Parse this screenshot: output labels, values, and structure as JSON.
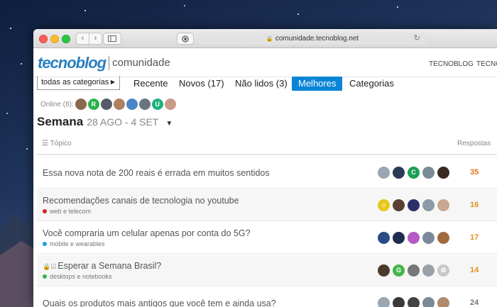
{
  "browser": {
    "url": "comunidade.tecnoblog.net",
    "nav_back": "‹",
    "nav_forward": "›",
    "reload": "↻"
  },
  "header": {
    "logo_main": "tecnoblog",
    "logo_sub": "comunidade",
    "links": [
      "TECNOBLOG",
      "TECNO"
    ]
  },
  "nav": {
    "categories_dropdown": "todas as categorias",
    "tabs": [
      "Recente",
      "Novos (17)",
      "Não lidos (3)",
      "Melhores",
      "Categorias"
    ],
    "active_tab": "Melhores"
  },
  "online": {
    "label": "Online (8):",
    "avatars": [
      {
        "letter": "",
        "color": "#8a6a4a"
      },
      {
        "letter": "R",
        "color": "#2bb24c"
      },
      {
        "letter": "",
        "color": "#555c66"
      },
      {
        "letter": "",
        "color": "#b08060"
      },
      {
        "letter": "",
        "color": "#4a86c8"
      },
      {
        "letter": "",
        "color": "#6a7480"
      },
      {
        "letter": "U",
        "color": "#1fb27c"
      },
      {
        "letter": "",
        "color": "#c89a88"
      }
    ]
  },
  "period": {
    "title": "Semana",
    "range": "28 AGO - 4 SET"
  },
  "table": {
    "topic_header": "Tópico",
    "replies_header": "Respostas",
    "rows": [
      {
        "title": "Essa nova nota de 200 reais é errada em muitos sentidos",
        "category": "",
        "category_color": "",
        "replies": "35",
        "replies_color": "#e8701a",
        "avatars": [
          {
            "letter": "",
            "color": "#9aa6b2"
          },
          {
            "letter": "",
            "color": "#2b3a55"
          },
          {
            "letter": "C",
            "color": "#1f9e55"
          },
          {
            "letter": "",
            "color": "#7a8a96"
          },
          {
            "letter": "",
            "color": "#3a2a22"
          }
        ]
      },
      {
        "title": "Recomendações canais de tecnologia no youtube",
        "category": "web e telecom",
        "category_color": "#d41e2a",
        "replies": "16",
        "replies_color": "#e0901a",
        "avatars": [
          {
            "letter": "☺",
            "color": "#e8c81a"
          },
          {
            "letter": "",
            "color": "#5a4030"
          },
          {
            "letter": "",
            "color": "#2b2f6a"
          },
          {
            "letter": "",
            "color": "#8a9aa6"
          },
          {
            "letter": "",
            "color": "#c8a890"
          }
        ]
      },
      {
        "title": "Você compraria um celular apenas por conta do 5G?",
        "category": "mobile e wearables",
        "category_color": "#1aa1e0",
        "replies": "17",
        "replies_color": "#e0901a",
        "avatars": [
          {
            "letter": "",
            "color": "#2a4a88"
          },
          {
            "letter": "",
            "color": "#1e2d50"
          },
          {
            "letter": "",
            "color": "#b65ac8"
          },
          {
            "letter": "",
            "color": "#7a8a9a"
          },
          {
            "letter": "",
            "color": "#a06a40"
          }
        ]
      },
      {
        "title": "Esperar a Semana Brasil?",
        "category": "desktops e notebooks",
        "category_color": "#2ab84a",
        "replies": "14",
        "replies_color": "#e0901a",
        "avatars": [
          {
            "letter": "",
            "color": "#4a3a2a"
          },
          {
            "letter": "G",
            "color": "#45b64a"
          },
          {
            "letter": "",
            "color": "#777777"
          },
          {
            "letter": "",
            "color": "#9aa0a8"
          },
          {
            "letter": "⚙",
            "color": "#c8c8c8"
          }
        ]
      },
      {
        "title": "Quais os produtos mais antigos que você tem e ainda usa?",
        "category": "",
        "category_color": "",
        "replies": "24",
        "replies_color": "#777777",
        "avatars": [
          {
            "letter": "",
            "color": "#9aa6b2"
          },
          {
            "letter": "",
            "color": "#3a3a3a"
          },
          {
            "letter": "",
            "color": "#444444"
          },
          {
            "letter": "",
            "color": "#7a8a96"
          },
          {
            "letter": "",
            "color": "#b08a6a"
          }
        ]
      }
    ]
  }
}
